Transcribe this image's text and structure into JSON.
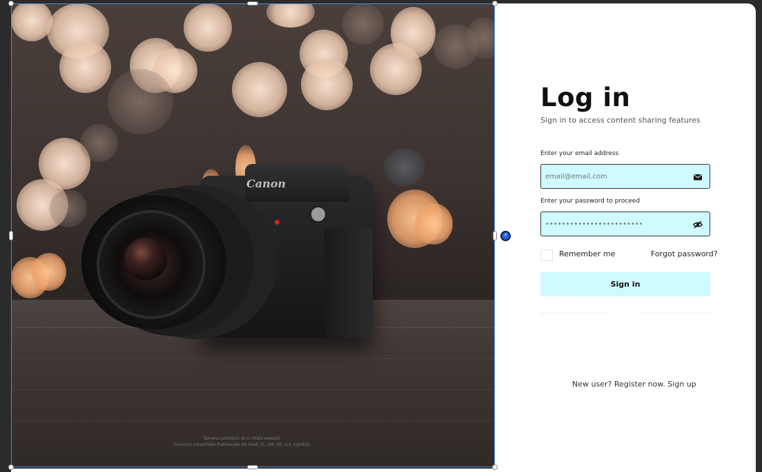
{
  "login": {
    "title": "Log in",
    "subtitle": "Sign in to access content sharing features",
    "email_label": "Enter your email address",
    "email_placeholder": "email@email.com",
    "password_label": "Enter your password to proceed",
    "password_placeholder": "••••••••••••••••••••••••",
    "remember_label": "Remember me",
    "forgot_label": "Forgot password?",
    "signin_label": "Sign in",
    "register_prompt": "New user? Register now.",
    "signup_label": "Sign up"
  },
  "photo": {
    "camera_brand": "Canon",
    "watermark_line1": "Tamara Lunchbox dt.cc Ktalu wakesit",
    "watermark_line2": "Camcam canonfolko Pullnoeyde hit hoeb 71. 5M. Slt. Lc5 rcpc6.ts"
  },
  "icons": {
    "email": "envelope-icon",
    "password": "eye-off-icon",
    "link": "lightning-icon"
  },
  "colors": {
    "input_bg": "#cffaff",
    "button_bg": "#cffaff",
    "selection": "#4a90e2"
  }
}
